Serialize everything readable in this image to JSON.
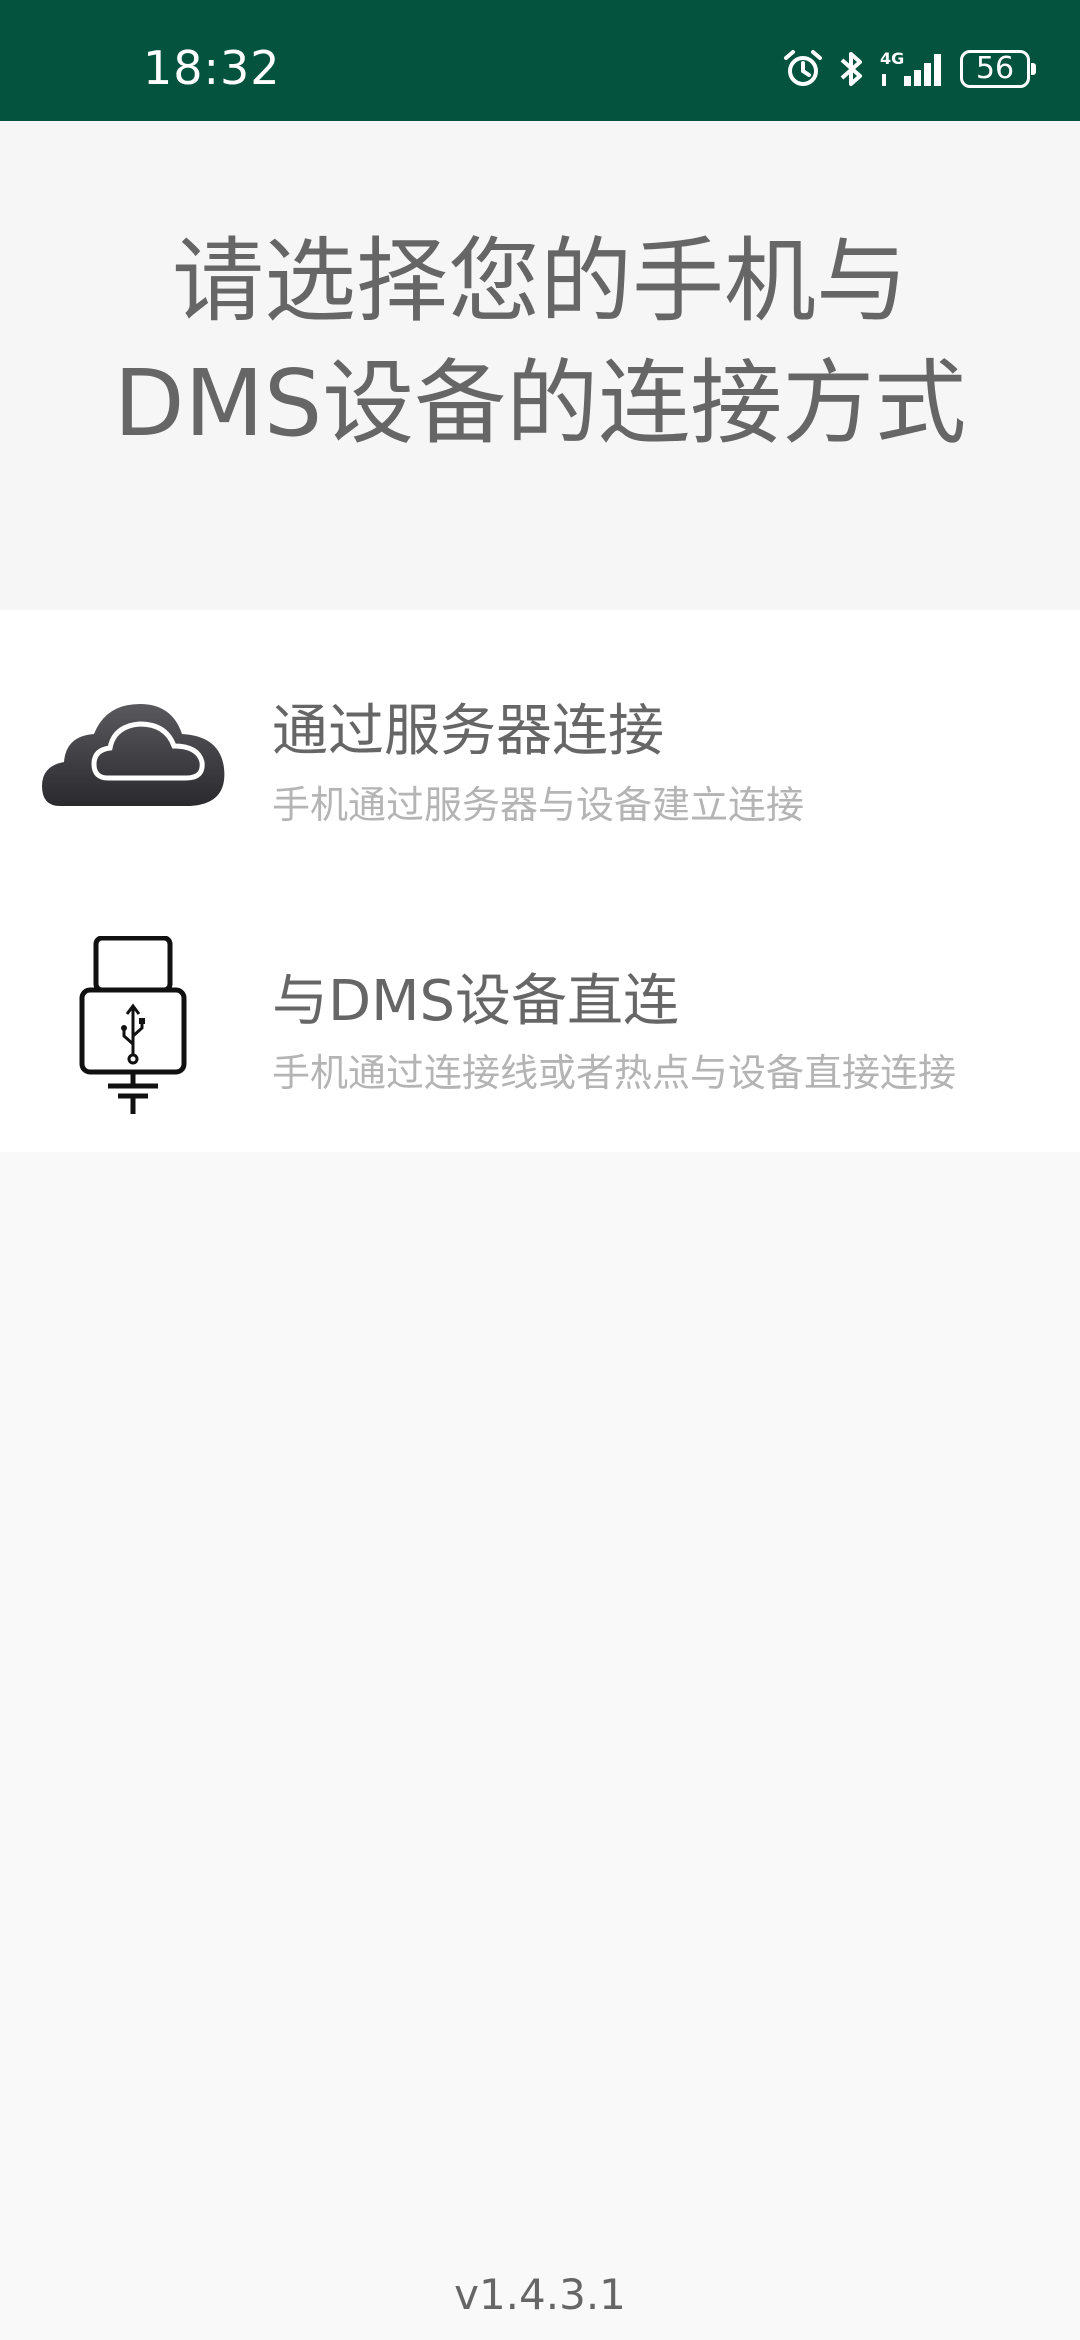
{
  "status_bar": {
    "time": "18:32",
    "network": "4G",
    "battery": "56",
    "icons": [
      "alarm-icon",
      "bluetooth-icon",
      "signal-4g-icon",
      "battery-icon"
    ]
  },
  "header": {
    "title_line1": "请选择您的手机与",
    "title_line2": "DMS设备的连接方式"
  },
  "options": [
    {
      "icon": "cloud-icon",
      "title": "通过服务器连接",
      "subtitle": "手机通过服务器与设备建立连接"
    },
    {
      "icon": "usb-plug-icon",
      "title": "与DMS设备直连",
      "subtitle": "手机通过连接线或者热点与设备直接连接"
    }
  ],
  "version": "v1.4.3.1",
  "colors": {
    "status_bar": "#03533f",
    "background": "#f9f9f9",
    "card": "#ffffff",
    "title_text": "#666666",
    "subtitle_text": "#b4b4b4"
  }
}
